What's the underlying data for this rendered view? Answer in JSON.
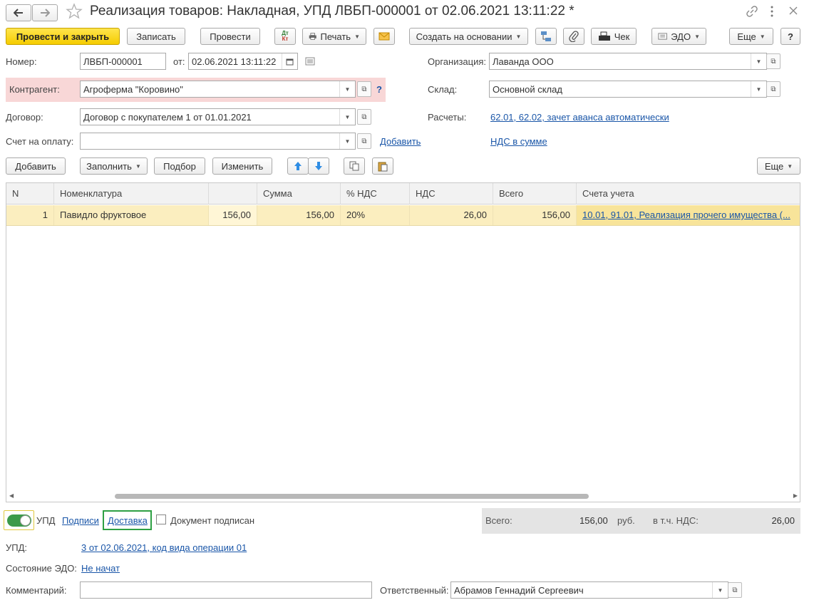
{
  "window": {
    "title": "Реализация товаров: Накладная, УПД ЛВБП-000001 от 02.06.2021 13:11:22 *"
  },
  "toolbar": {
    "post_close": "Провести и закрыть",
    "save": "Записать",
    "post": "Провести",
    "dtkt_icon": "Дт Кт",
    "print": "Печать",
    "create_based": "Создать на основании",
    "check": "Чек",
    "edo": "ЭДО",
    "more": "Еще",
    "help": "?"
  },
  "header": {
    "number_label": "Номер:",
    "number_value": "ЛВБП-000001",
    "date_label": "от:",
    "date_value": "02.06.2021 13:11:22",
    "org_label": "Организация:",
    "org_value": "Лаванда ООО",
    "contractor_label": "Контрагент:",
    "contractor_value": "Агроферма \"Коровино\"",
    "contractor_help": "?",
    "warehouse_label": "Склад:",
    "warehouse_value": "Основной склад",
    "contract_label": "Договор:",
    "contract_value": "Договор с покупателем 1 от 01.01.2021",
    "settlements_label": "Расчеты:",
    "settlements_link": "62.01, 62.02, зачет аванса автоматически",
    "invoice_label": "Счет на оплату:",
    "invoice_value": "",
    "invoice_add": "Добавить",
    "vat_link": "НДС в сумме"
  },
  "table_toolbar": {
    "add": "Добавить",
    "fill": "Заполнить",
    "select": "Подбор",
    "change": "Изменить",
    "more": "Еще"
  },
  "table": {
    "columns": [
      "N",
      "Номенклатура",
      "",
      "Сумма",
      "% НДС",
      "НДС",
      "Всего",
      "Счета учета"
    ],
    "rows": [
      {
        "n": "1",
        "item": "Павидло фруктовое",
        "qty": "156,00",
        "sum": "156,00",
        "vat_rate": "20%",
        "vat": "26,00",
        "total": "156,00",
        "accounts": "10.01, 91.01, Реализация прочего имущества (..."
      }
    ]
  },
  "footer": {
    "upd_toggle_label": "УПД",
    "upd_toggle_on": true,
    "signatures_link": "Подписи",
    "delivery_link": "Доставка",
    "signed_label": "Документ подписан",
    "total_label": "Всего:",
    "total_value": "156,00",
    "currency": "руб.",
    "vat_incl_label": "в т.ч. НДС:",
    "vat_value": "26,00",
    "upd_label": "УПД:",
    "upd_link": "3 от 02.06.2021, код вида операции 01",
    "edo_state_label": "Состояние ЭДО:",
    "edo_state_link": "Не начат",
    "comment_label": "Комментарий:",
    "comment_value": "",
    "responsible_label": "Ответственный:",
    "responsible_value": "Абрамов Геннадий Сергеевич"
  },
  "colors": {
    "primary_button": "#f5cc00",
    "selected_row": "#fbeebf",
    "link": "#1a56a8",
    "contractor_highlight": "#f8d7d7",
    "delivery_highlight": "#2ea043",
    "toggle_on": "#3c9a4a"
  }
}
